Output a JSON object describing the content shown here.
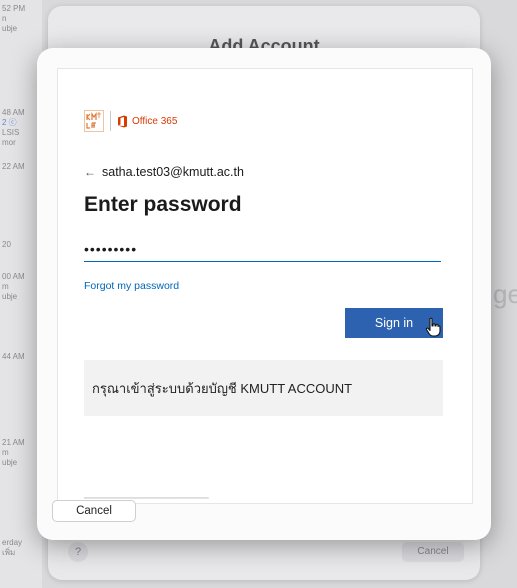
{
  "background": {
    "list_items": [
      {
        "time": "52 PM",
        "lines": [
          "n",
          "ubje"
        ]
      },
      {
        "time": "48 AM",
        "lines": [
          "2 ⓒ",
          "LSIS",
          "mor"
        ]
      },
      {
        "time": "22 AM",
        "lines": []
      },
      {
        "time": "20",
        "lines": []
      },
      {
        "time": "00 AM",
        "lines": [
          "m",
          "ubje"
        ]
      },
      {
        "time": "44 AM",
        "lines": []
      },
      {
        "time": "21 AM",
        "lines": [
          "m",
          "ubje"
        ]
      },
      {
        "time": "erday",
        "lines": [
          "เพิ่ม"
        ]
      }
    ],
    "sheet_title": "Add Account",
    "help_label": "?",
    "cancel_label": "Cancel",
    "partial_text": "ge"
  },
  "dialog": {
    "logo_text": "Office 365",
    "account_email": "satha.test03@kmutt.ac.th",
    "heading": "Enter password",
    "password_value": "•••••••••",
    "forgot_link": "Forgot my password",
    "signin_label": "Sign in",
    "notice_text": "กรุณาเข้าสู่ระบบด้วยบัญชี KMUTT ACCOUNT",
    "cancel_label": "Cancel"
  },
  "colors": {
    "primary_button": "#2d62b0",
    "link": "#0067b8",
    "office_orange": "#d83b01"
  }
}
